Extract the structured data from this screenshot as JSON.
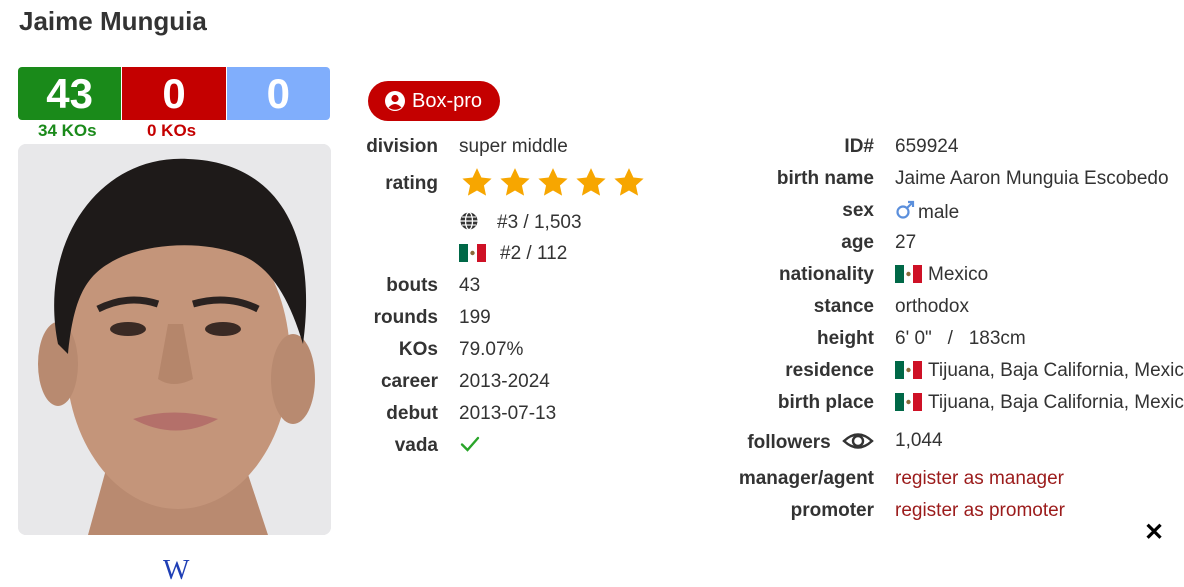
{
  "boxer": {
    "name": "Jaime Munguia"
  },
  "record": {
    "wins": "43",
    "losses": "0",
    "draws": "0",
    "wins_kos": "34 KOs",
    "losses_kos": "0 KOs"
  },
  "badge": {
    "label": "Box-pro"
  },
  "left_info": {
    "division_label": "division",
    "division_value": "super middle",
    "rating_label": "rating",
    "rating_stars": 5,
    "world_rank": "#3 / 1,503",
    "country_rank": "#2 / 112",
    "bouts_label": "bouts",
    "bouts_value": "43",
    "rounds_label": "rounds",
    "rounds_value": "199",
    "kos_label": "KOs",
    "kos_value": "79.07%",
    "career_label": "career",
    "career_value": "2013-2024",
    "debut_label": "debut",
    "debut_value": "2013-07-13",
    "vada_label": "vada"
  },
  "right_info": {
    "id_label": "ID#",
    "id_value": "659924",
    "birthname_label": "birth name",
    "birthname_value": "Jaime Aaron Munguia Escobedo",
    "sex_label": "sex",
    "sex_value": "male",
    "age_label": "age",
    "age_value": "27",
    "nationality_label": "nationality",
    "nationality_value": "Mexico",
    "stance_label": "stance",
    "stance_value": "orthodox",
    "height_label": "height",
    "height_value": "6' 0\"   /   183cm",
    "residence_label": "residence",
    "residence_value": "Tijuana, Baja California, Mexico",
    "birthplace_label": "birth place",
    "birthplace_value": "Tijuana, Baja California, Mexico",
    "followers_label": "followers",
    "followers_value": "1,044",
    "manager_label": "manager/agent",
    "manager_value": "register as manager",
    "promoter_label": "promoter",
    "promoter_value": "register as promoter"
  },
  "colors": {
    "win": "#1a8a1a",
    "loss": "#c40000",
    "draw": "#80aefc",
    "star": "#f7a600",
    "link": "#9b1b1b"
  },
  "icons": [
    "user-circle-icon",
    "globe-icon",
    "mexico-flag-icon",
    "male-icon",
    "eye-icon",
    "check-icon",
    "wikipedia-icon",
    "close-icon"
  ],
  "wiki": {
    "glyph": "W"
  },
  "close": {
    "glyph": "✕"
  }
}
